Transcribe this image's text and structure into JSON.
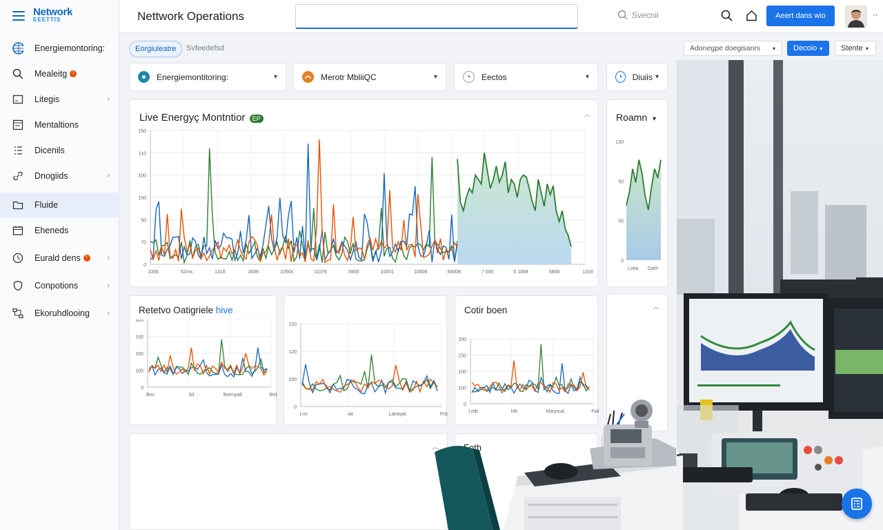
{
  "app": {
    "logo_line1": "Network",
    "logo_line2": "EEETTIS",
    "page_title": "Nettwork Operations",
    "search_label": "Svecnii",
    "alert_button": "Aeert dans wio",
    "more": "··"
  },
  "sidebar": {
    "items": [
      {
        "label": "Energiemontoring:",
        "icon": "globe-icon"
      },
      {
        "label": "Mealeitg",
        "icon": "search-icon",
        "badge": "!"
      },
      {
        "label": "Litegis",
        "icon": "window-icon"
      },
      {
        "label": "Mentaltions",
        "icon": "panel-icon"
      },
      {
        "label": "Dicenils",
        "icon": "list-icon"
      },
      {
        "label": "Dnogiids",
        "icon": "link-icon"
      },
      {
        "label": "Fluide",
        "icon": "folder-icon"
      },
      {
        "label": "Eheneds",
        "icon": "calendar-icon"
      },
      {
        "label": "Eurald dens",
        "icon": "clock-icon",
        "badge": "!"
      },
      {
        "label": "Conpotions",
        "icon": "shield-icon"
      },
      {
        "label": "Ekoruhdlooing",
        "icon": "network-icon"
      }
    ]
  },
  "tabs": {
    "active": "Eorgiuleatre",
    "other": "Svfeedefsd"
  },
  "dropdowns": [
    {
      "label": "Energiemontitoring:",
      "color": "#1e88a8"
    },
    {
      "label": "Merotr MbliiQC",
      "color": "#e67e22"
    },
    {
      "label": "Eectos",
      "color": "#9aa0a6"
    },
    {
      "label": "Diuiis",
      "color": "#1a73e8"
    }
  ],
  "right_toolbar": {
    "select": "Adonegpe doegisanrs",
    "primary": "Decoio",
    "secondary": "Stente"
  },
  "panels": {
    "main": {
      "title": "Live Energyç Montntior",
      "badge": "EP"
    },
    "side": {
      "title": "Roamn"
    },
    "small1": {
      "title_a": "Retetvo Oatigriele",
      "title_b": " hive"
    },
    "small3": {
      "title": "Cotir boen"
    },
    "bottom": {
      "title": "Foth"
    }
  },
  "chart_data": [
    {
      "type": "line",
      "title": "Live Energyç Montntior",
      "y_ticks": [
        "150",
        "110",
        "100",
        "150",
        "50",
        "70",
        "0"
      ],
      "x_ticks": [
        "1006",
        "52ros",
        "1318",
        "3006",
        "1050s",
        "11078",
        "5900",
        "10001",
        "10008",
        "50008",
        "7 000",
        "5 1008",
        "5808",
        "1318"
      ],
      "series_colors": [
        "#2e7d32",
        "#1565c0",
        "#e65100"
      ],
      "ylim": [
        0,
        150
      ]
    },
    {
      "type": "area",
      "title": "Roamn",
      "y_ticks": [
        "130",
        "50",
        "50",
        "0"
      ],
      "x_ticks": [
        "Lvea",
        "Darh"
      ],
      "ylim": [
        0,
        130
      ]
    },
    {
      "type": "line",
      "title": "Retetvo Oatigriele hive",
      "y_ticks": [
        "300",
        "100",
        "100",
        "100",
        "0"
      ],
      "x_ticks": [
        "Bnv",
        "lid",
        "Bvenyatl",
        "Bnb"
      ]
    },
    {
      "type": "line",
      "y_ticks": [
        "120",
        "120",
        "100",
        "0"
      ],
      "x_ticks": [
        "Lnv",
        "iat",
        "Latrayat",
        "Fnb"
      ]
    },
    {
      "type": "line",
      "title": "Cotir boen",
      "y_ticks": [
        "200",
        "250",
        "100",
        "100",
        "0"
      ],
      "x_ticks": [
        "Lmb",
        "Ivb",
        "Marysud",
        "Faib"
      ]
    }
  ]
}
